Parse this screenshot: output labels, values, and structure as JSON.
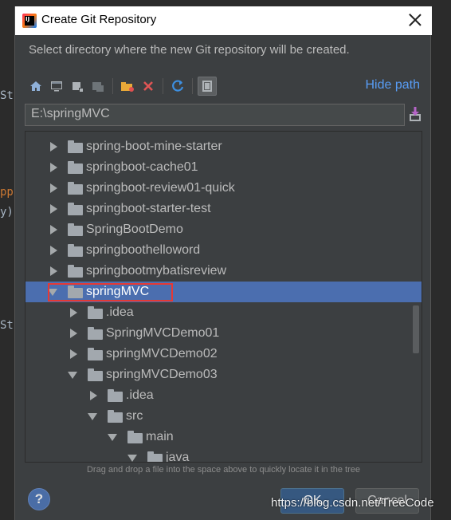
{
  "background_code": {
    "frag1": "St",
    "frag2": "pp",
    "frag3": "y)",
    "frag4": "St"
  },
  "dialog": {
    "title": "Create Git Repository",
    "app_icon_letters": "IJ",
    "description": "Select directory where the new Git repository will be created.",
    "hide_path": "Hide path",
    "path_value": "E:\\springMVC",
    "hint": "Drag and drop a file into the space above to quickly locate it in the tree",
    "help_label": "?",
    "ok_label": "OK",
    "cancel_label": "Cancel"
  },
  "toolbar": {
    "buttons": [
      "home-icon",
      "desktop-icon",
      "module-icon",
      "project-icon",
      "new-folder-icon",
      "delete-icon",
      "refresh-icon",
      "show-hidden-icon"
    ]
  },
  "tree": {
    "rows": [
      {
        "label": "spring-boot-mine-starter",
        "expanded": false
      },
      {
        "label": "springboot-cache01",
        "expanded": false
      },
      {
        "label": "springboot-review01-quick",
        "expanded": false
      },
      {
        "label": "springboot-starter-test",
        "expanded": false
      },
      {
        "label": "SpringBootDemo",
        "expanded": false
      },
      {
        "label": "springboothelloword",
        "expanded": false
      },
      {
        "label": "springbootmybatisreview",
        "expanded": false
      },
      {
        "label": "springMVC",
        "expanded": true,
        "selected": true
      },
      {
        "label": ".idea",
        "expanded": false
      },
      {
        "label": "SpringMVCDemo01",
        "expanded": false
      },
      {
        "label": "springMVCDemo02",
        "expanded": false
      },
      {
        "label": "springMVCDemo03",
        "expanded": true
      },
      {
        "label": ".idea",
        "expanded": false
      },
      {
        "label": "src",
        "expanded": true
      },
      {
        "label": "main",
        "expanded": true
      },
      {
        "label": "java",
        "expanded": true
      }
    ]
  },
  "watermark": "https://blog.csdn.net/TreeCode",
  "colors": {
    "selection": "#4b6eaf",
    "highlight_box": "#e53935",
    "link": "#589df6"
  }
}
